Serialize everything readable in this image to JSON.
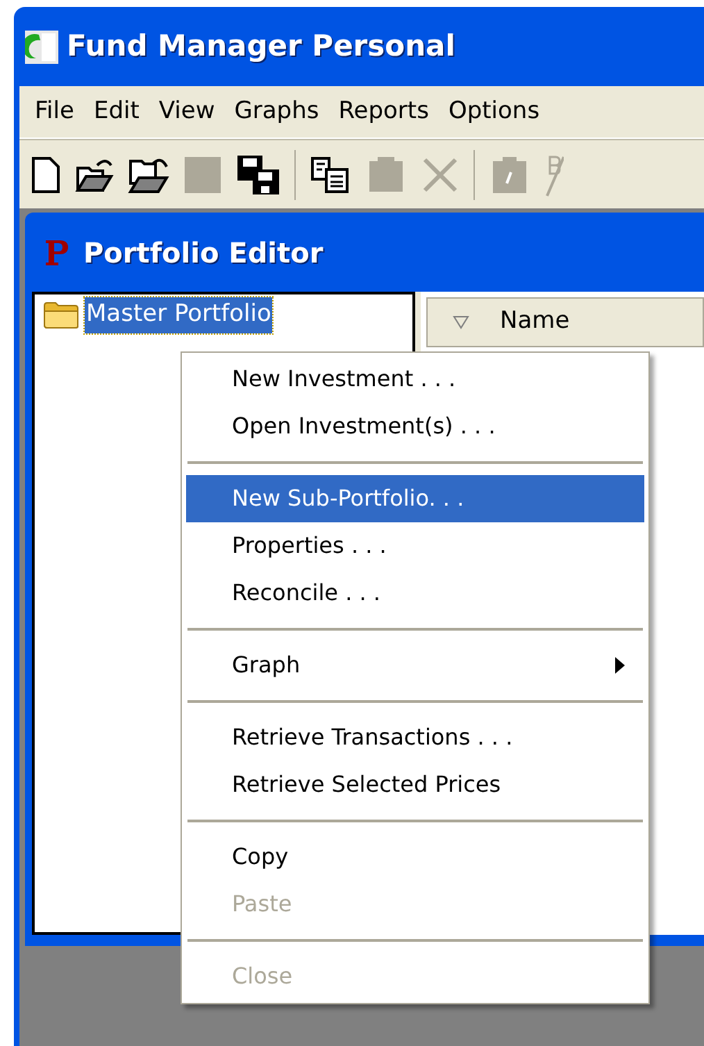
{
  "window": {
    "title": "Fund Manager Personal"
  },
  "menu_bar": [
    {
      "label": "File"
    },
    {
      "label": "Edit"
    },
    {
      "label": "View"
    },
    {
      "label": "Graphs"
    },
    {
      "label": "Reports"
    },
    {
      "label": "Options"
    }
  ],
  "child_window": {
    "title": "Portfolio Editor"
  },
  "tree": {
    "items": [
      {
        "label": "Master Portfolio",
        "selected": true
      }
    ]
  },
  "list": {
    "columns": [
      {
        "label": "Name"
      }
    ]
  },
  "context_menu": {
    "items": [
      {
        "kind": "item",
        "label": "New Investment . . .",
        "selected": false,
        "disabled": false
      },
      {
        "kind": "item",
        "label": "Open Investment(s) . . .",
        "selected": false,
        "disabled": false
      },
      {
        "kind": "separator"
      },
      {
        "kind": "item",
        "label": "New Sub-Portfolio. . .",
        "selected": true,
        "disabled": false
      },
      {
        "kind": "item",
        "label": "Properties . . .",
        "selected": false,
        "disabled": false
      },
      {
        "kind": "item",
        "label": "Reconcile . . .",
        "selected": false,
        "disabled": false
      },
      {
        "kind": "separator"
      },
      {
        "kind": "submenu",
        "label": "Graph",
        "selected": false,
        "disabled": false
      },
      {
        "kind": "separator"
      },
      {
        "kind": "item",
        "label": "Retrieve Transactions . . .",
        "selected": false,
        "disabled": false
      },
      {
        "kind": "item",
        "label": "Retrieve Selected Prices",
        "selected": false,
        "disabled": false
      },
      {
        "kind": "separator"
      },
      {
        "kind": "item",
        "label": "Copy",
        "selected": false,
        "disabled": false
      },
      {
        "kind": "item",
        "label": "Paste",
        "selected": false,
        "disabled": true
      },
      {
        "kind": "separator"
      },
      {
        "kind": "item",
        "label": "Close",
        "selected": false,
        "disabled": true
      }
    ]
  }
}
